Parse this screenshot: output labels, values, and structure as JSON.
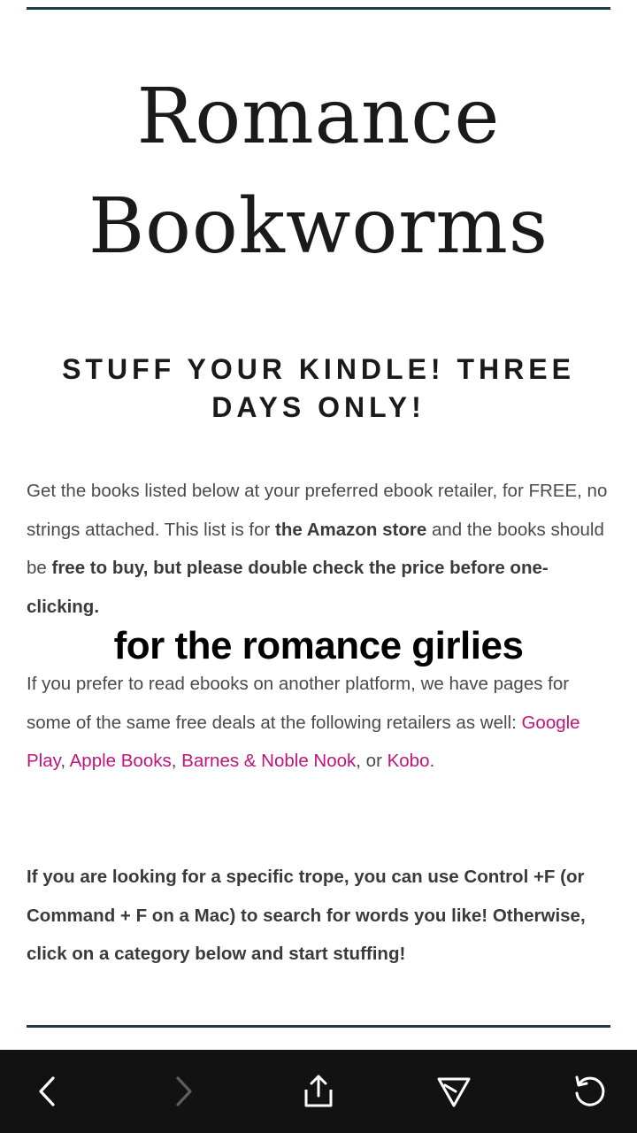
{
  "site": {
    "title_line1": "Romance",
    "title_line2": "Bookworms"
  },
  "article": {
    "headline_line1": "STUFF YOUR KINDLE! THREE",
    "headline_line2": "DAYS ONLY!",
    "p1": {
      "t1": "Get the books listed below at your preferred ebook retailer, for FREE, no strings attached. This list is for ",
      "b1": "the Amazon store",
      "t2": " and the books should be ",
      "b2": "free to buy, but please double check the price before one-clicking."
    },
    "overlay_caption": "for the romance girlies",
    "p2": {
      "t1": "If you prefer to read ebooks on another platform, we have pages for some of the same free deals at the following retailers as well: ",
      "link_google": "Google Play",
      "sep1": ", ",
      "link_apple": "Apple Books",
      "sep2": ", ",
      "link_bn": "Barnes & Noble Nook",
      "sep3": ", or ",
      "link_kobo": "Kobo",
      "end": "."
    },
    "p3": "If you are looking for a specific trope, you can use Control +F (or Command + F on a Mac) to search for words you like! Otherwise, click on a category below and start stuffing!"
  },
  "navbar": {
    "icons": [
      "back-arrow-icon",
      "forward-arrow-icon",
      "share-icon",
      "send-icon",
      "reload-icon"
    ]
  },
  "colors": {
    "link": "#c0147b",
    "rule": "#1f3b4d",
    "navbar_bg": "#121212"
  }
}
